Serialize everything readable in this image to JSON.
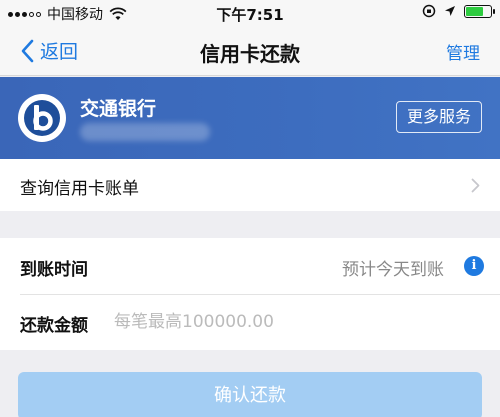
{
  "status_bar": {
    "carrier": "中国移动",
    "time": "下午7:51"
  },
  "nav": {
    "back_label": "返回",
    "title": "信用卡还款",
    "manage_label": "管理"
  },
  "bank": {
    "name": "交通银行",
    "more_services_label": "更多服务"
  },
  "bill": {
    "label": "查询信用卡账单"
  },
  "form": {
    "arrival_label": "到账时间",
    "arrival_value": "预计今天到账",
    "info_icon": "i",
    "amount_label": "还款金额",
    "amount_value": "",
    "amount_placeholder": "每笔最高100000.00"
  },
  "confirm": {
    "label": "确认还款"
  },
  "colors": {
    "accent": "#1f7ae0",
    "banner": "#3d6dbf",
    "button_disabled": "#a3cdf3"
  }
}
